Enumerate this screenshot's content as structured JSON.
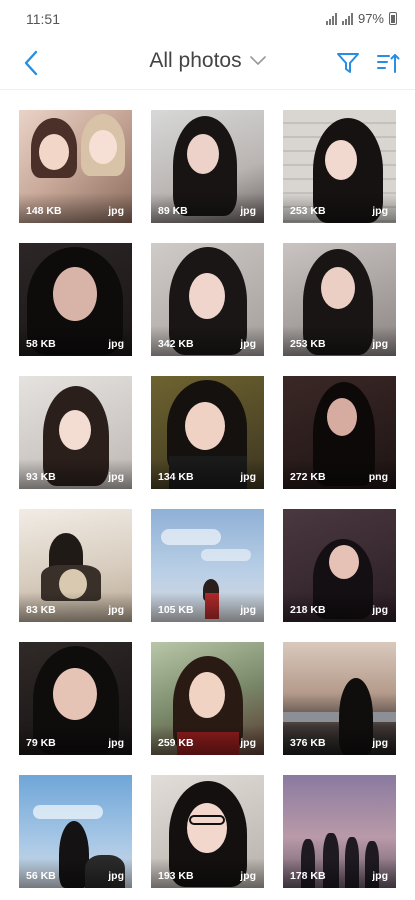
{
  "status": {
    "time": "11:51",
    "battery": "97%"
  },
  "header": {
    "title": "All photos"
  },
  "icons": {
    "back": "chevron-left-icon",
    "dropdown": "chevron-down-icon",
    "filter": "filter-icon",
    "sort": "sort-icon"
  },
  "colors": {
    "accent": "#2a8ee0",
    "title": "#444444"
  },
  "photos": [
    {
      "size": "148 KB",
      "ext": "jpg"
    },
    {
      "size": "89 KB",
      "ext": "jpg"
    },
    {
      "size": "253 KB",
      "ext": "jpg"
    },
    {
      "size": "58 KB",
      "ext": "jpg"
    },
    {
      "size": "342 KB",
      "ext": "jpg"
    },
    {
      "size": "253 KB",
      "ext": "jpg"
    },
    {
      "size": "93 KB",
      "ext": "jpg"
    },
    {
      "size": "134 KB",
      "ext": "jpg"
    },
    {
      "size": "272 KB",
      "ext": "png"
    },
    {
      "size": "83 KB",
      "ext": "jpg"
    },
    {
      "size": "105 KB",
      "ext": "jpg"
    },
    {
      "size": "218 KB",
      "ext": "jpg"
    },
    {
      "size": "79 KB",
      "ext": "jpg"
    },
    {
      "size": "259 KB",
      "ext": "jpg"
    },
    {
      "size": "376 KB",
      "ext": "jpg"
    },
    {
      "size": "56 KB",
      "ext": "jpg"
    },
    {
      "size": "193 KB",
      "ext": "jpg"
    },
    {
      "size": "178 KB",
      "ext": "jpg"
    }
  ]
}
